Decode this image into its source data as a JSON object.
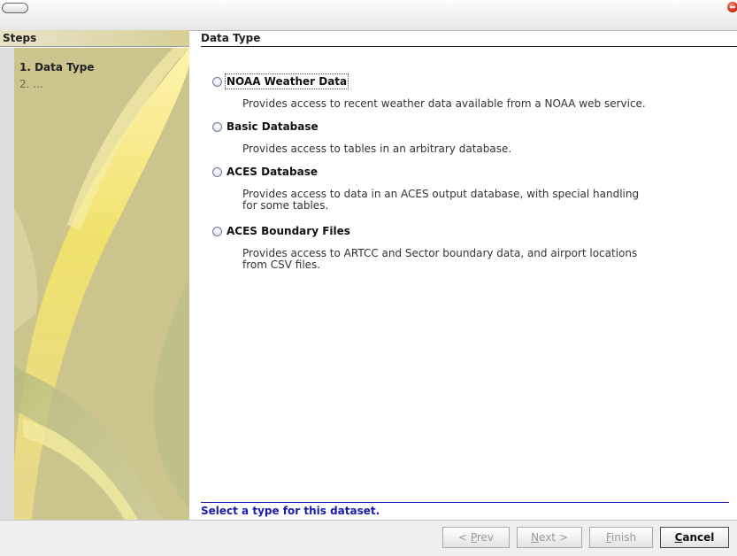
{
  "window": {
    "title": ""
  },
  "steps": {
    "title": "Steps",
    "items": [
      "1. Data Type",
      "2. ..."
    ]
  },
  "page": {
    "title": "Data Type",
    "options": [
      {
        "label": "NOAA Weather Data",
        "description": "Provides access to recent weather data available from a NOAA web service."
      },
      {
        "label": "Basic Database",
        "description": "Provides access to tables in an arbitrary database."
      },
      {
        "label": "ACES Database",
        "description": "Provides access to data in an ACES output database, with special handling for some tables."
      },
      {
        "label": "ACES Boundary Files",
        "description": "Provides access to ARTCC and Sector boundary data, and airport locations from CSV files."
      }
    ],
    "status": "Select a type for this dataset."
  },
  "buttons": {
    "prev": {
      "before": "< ",
      "mnemonic": "P",
      "after": "rev"
    },
    "next": {
      "before": "",
      "mnemonic": "N",
      "after": "ext >"
    },
    "finish": {
      "before": "",
      "mnemonic": "F",
      "after": "inish"
    },
    "cancel": {
      "before": "",
      "mnemonic": "C",
      "after": "ancel"
    }
  },
  "icons": {
    "minimize": "pill-icon",
    "close": "close-icon",
    "radio": "radio-icon"
  },
  "colors": {
    "status_text": "#1a1ab0",
    "close": "#d8331b"
  }
}
